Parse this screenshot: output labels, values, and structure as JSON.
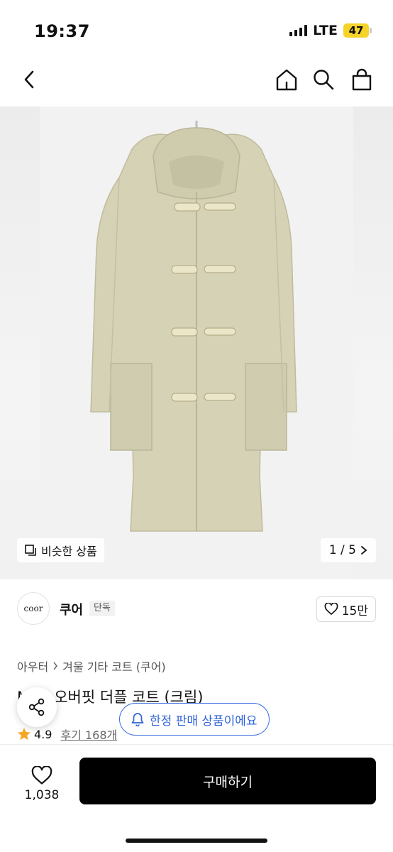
{
  "status_bar": {
    "time": "19:37",
    "network": "LTE",
    "battery": "47"
  },
  "nav": {
    "back_icon": "chevron-left-icon",
    "home_icon": "home-icon",
    "search_icon": "search-icon",
    "bag_icon": "shopping-bag-icon"
  },
  "gallery": {
    "similar_label": "비슷한 상품",
    "pager_text": "1 / 5",
    "coat_color": "#d6d2b6"
  },
  "brand": {
    "logo_text": "coor",
    "name": "쿠어",
    "badge": "단독",
    "likes": "15만"
  },
  "breadcrumb": {
    "items": [
      "아우터",
      "겨울 기타 코트 (쿠어)"
    ]
  },
  "product": {
    "title": "MTR 오버핏 더플 코트 (크림)",
    "rating": "4.9",
    "reviews": "후기 168개"
  },
  "notice": {
    "limited_label": "한정 판매 상품이에요"
  },
  "bottom_bar": {
    "wish_count": "1,038",
    "buy_label": "구매하기"
  },
  "colors": {
    "accent_blue": "#2f63d8",
    "battery_yellow": "#f5d328",
    "star": "#f5a623"
  }
}
